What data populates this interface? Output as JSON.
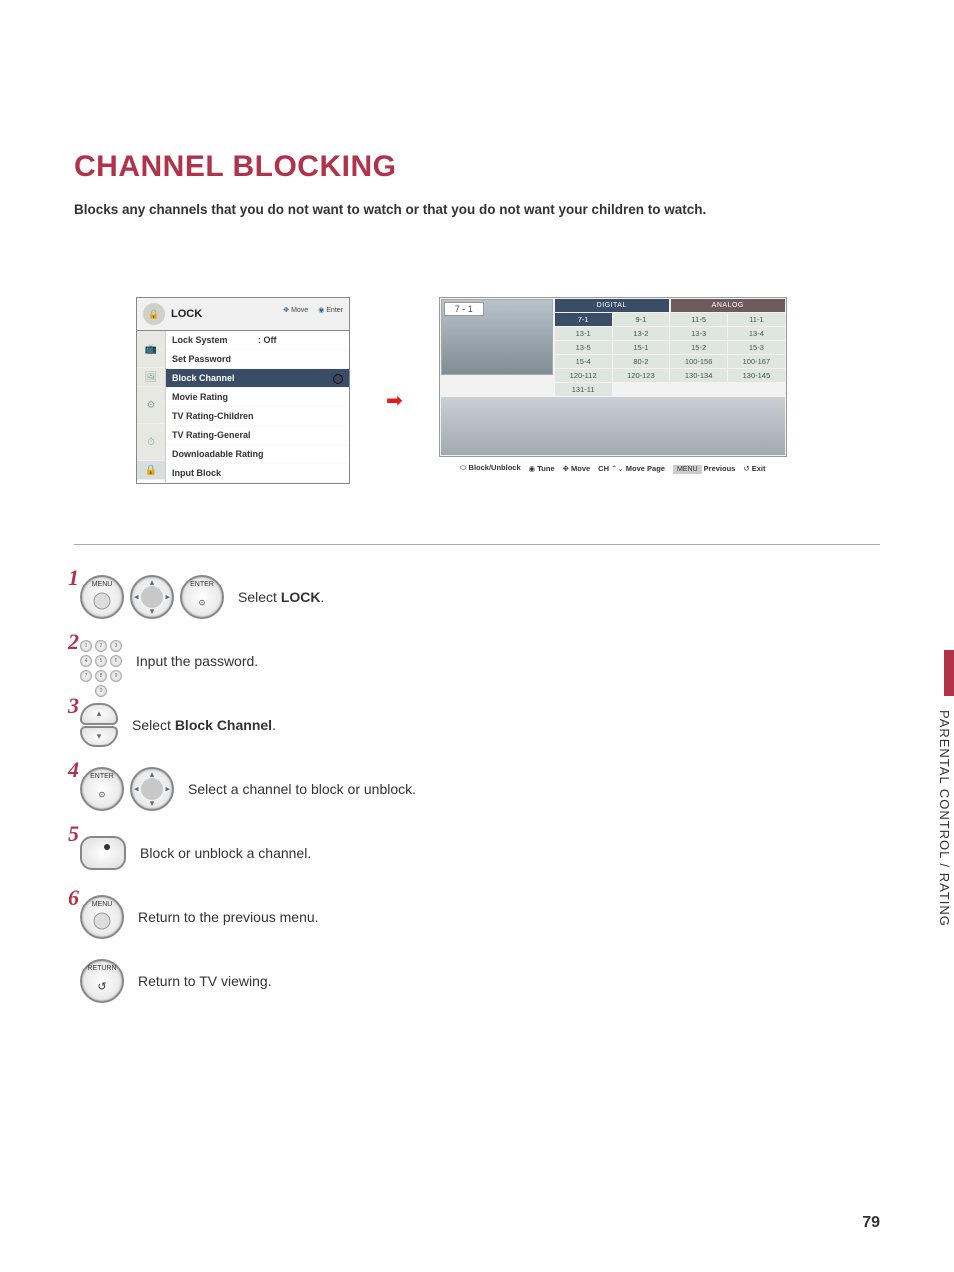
{
  "page_title": "CHANNEL BLOCKING",
  "subtitle": "Blocks any channels that you do not want to watch or that you do not want your children to watch.",
  "side_label": "PARENTAL CONTROL / RATING",
  "page_number": "79",
  "menu": {
    "title": "LOCK",
    "hints": {
      "move": "Move",
      "enter": "Enter"
    },
    "items": [
      {
        "label": "Lock System",
        "value": ": Off"
      },
      {
        "label": "Set Password",
        "value": ""
      },
      {
        "label": "Block Channel",
        "value": ""
      },
      {
        "label": "Movie Rating",
        "value": ""
      },
      {
        "label": "TV Rating-Children",
        "value": ""
      },
      {
        "label": "TV Rating-General",
        "value": ""
      },
      {
        "label": "Downloadable Rating",
        "value": ""
      },
      {
        "label": "Input Block",
        "value": ""
      }
    ]
  },
  "channel_screen": {
    "current": "7 - 1",
    "tabs": {
      "digital": "DIGITAL",
      "analog": "ANALOG"
    },
    "cells": [
      "7-1",
      "9-1",
      "11-5",
      "11-1",
      "13-1",
      "13-2",
      "13-3",
      "13-4",
      "13-5",
      "15-1",
      "15-2",
      "15-3",
      "15-4",
      "80-2",
      "100-156",
      "100-167",
      "120-112",
      "120-123",
      "130-134",
      "130-145",
      "131-11"
    ],
    "hints": {
      "block": "Block/Unblock",
      "tune": "Tune",
      "move": "Move",
      "ch": "CH",
      "page": "Move Page",
      "menu": "MENU",
      "prev": "Previous",
      "exit": "Exit"
    }
  },
  "steps": {
    "s1": {
      "num": "1",
      "btn1": "MENU",
      "btn2": "ENTER",
      "text_pre": "Select ",
      "bold": "LOCK",
      "text_post": "."
    },
    "s2": {
      "num": "2",
      "text": "Input the password."
    },
    "s3": {
      "num": "3",
      "text_pre": "Select ",
      "bold": "Block Channel",
      "text_post": "."
    },
    "s4": {
      "num": "4",
      "btn1": "ENTER",
      "text": "Select a channel to block or unblock."
    },
    "s5": {
      "num": "5",
      "text": "Block or unblock a channel."
    },
    "s6": {
      "num": "6",
      "btn1": "MENU",
      "text": "Return to the previous menu."
    },
    "s7": {
      "btn1": "RETURN",
      "text": "Return to TV viewing."
    }
  }
}
